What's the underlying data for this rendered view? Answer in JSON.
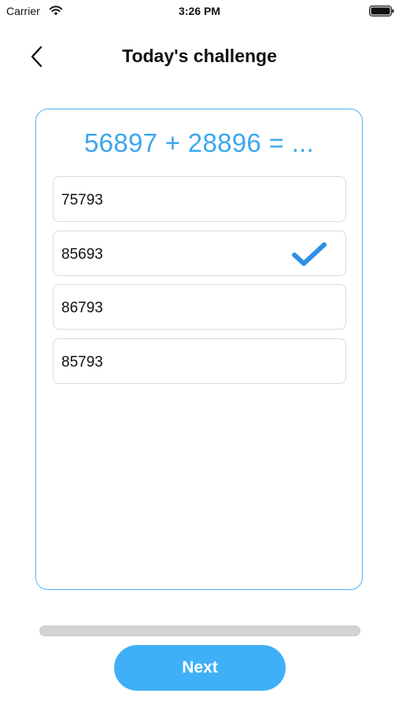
{
  "status_bar": {
    "carrier": "Carrier",
    "time": "3:26 PM"
  },
  "header": {
    "title": "Today's challenge",
    "back_icon": "chevron-left-icon"
  },
  "challenge": {
    "question": "56897 + 28896 = ...",
    "options": [
      {
        "label": "75793",
        "selected": false
      },
      {
        "label": "85693",
        "selected": true
      },
      {
        "label": "86793",
        "selected": false
      },
      {
        "label": "85793",
        "selected": false
      }
    ],
    "selected_icon": "checkmark-icon"
  },
  "progress": {
    "value": 0
  },
  "footer": {
    "next_label": "Next"
  },
  "colors": {
    "accent": "#3fb0f7",
    "question": "#3aa7ef",
    "card_border": "#4db3f5",
    "check": "#2f8fe3",
    "progress_track": "#d3d3d6"
  }
}
